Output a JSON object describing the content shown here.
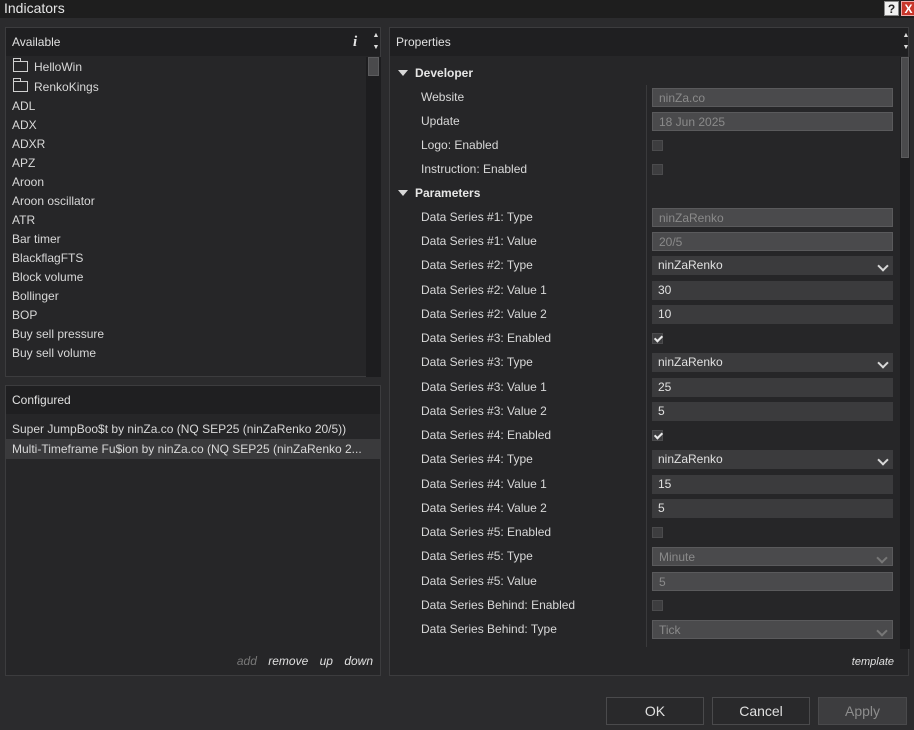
{
  "window": {
    "title": "Indicators",
    "help_label": "?",
    "close_label": "X"
  },
  "available": {
    "header": "Available",
    "info_label": "i",
    "items": [
      {
        "label": "HelloWin",
        "folder": true
      },
      {
        "label": "RenkoKings",
        "folder": true
      },
      {
        "label": "ADL"
      },
      {
        "label": "ADX"
      },
      {
        "label": "ADXR"
      },
      {
        "label": "APZ"
      },
      {
        "label": "Aroon"
      },
      {
        "label": "Aroon oscillator"
      },
      {
        "label": "ATR"
      },
      {
        "label": "Bar timer"
      },
      {
        "label": "BlackflagFTS"
      },
      {
        "label": "Block volume"
      },
      {
        "label": "Bollinger"
      },
      {
        "label": "BOP"
      },
      {
        "label": "Buy sell pressure"
      },
      {
        "label": "Buy sell volume"
      }
    ]
  },
  "configured": {
    "header": "Configured",
    "items": [
      "Super JumpBoo$t by ninZa.co (NQ SEP25 (ninZaRenko 20/5))",
      "Multi-Timeframe Fu$ion by ninZa.co (NQ SEP25 (ninZaRenko 2..."
    ],
    "selected_index": 1,
    "actions": {
      "add": "add",
      "remove": "remove",
      "up": "up",
      "down": "down"
    }
  },
  "properties": {
    "header": "Properties",
    "template_label": "template",
    "developer": {
      "title": "Developer",
      "rows": [
        {
          "label": "Website",
          "kind": "text",
          "value": "ninZa.co",
          "disabled": true
        },
        {
          "label": "Update",
          "kind": "text",
          "value": "18 Jun 2025",
          "disabled": true
        },
        {
          "label": "Logo: Enabled",
          "kind": "check",
          "checked": false
        },
        {
          "label": "Instruction: Enabled",
          "kind": "check",
          "checked": false
        }
      ]
    },
    "parameters": {
      "title": "Parameters",
      "rows": [
        {
          "label": "Data Series #1: Type",
          "kind": "text",
          "value": "ninZaRenko",
          "disabled": true
        },
        {
          "label": "Data Series #1: Value",
          "kind": "text",
          "value": "20/5",
          "disabled": true
        },
        {
          "label": "Data Series #2: Type",
          "kind": "select",
          "value": "ninZaRenko",
          "disabled": false
        },
        {
          "label": "Data Series #2: Value 1",
          "kind": "text",
          "value": "30",
          "disabled": false
        },
        {
          "label": "Data Series #2: Value 2",
          "kind": "text",
          "value": "10",
          "disabled": false
        },
        {
          "label": "Data Series #3: Enabled",
          "kind": "check",
          "checked": true
        },
        {
          "label": "Data Series #3: Type",
          "kind": "select",
          "value": "ninZaRenko",
          "disabled": false
        },
        {
          "label": "Data Series #3: Value 1",
          "kind": "text",
          "value": "25",
          "disabled": false
        },
        {
          "label": "Data Series #3: Value 2",
          "kind": "text",
          "value": "5",
          "disabled": false
        },
        {
          "label": "Data Series #4: Enabled",
          "kind": "check",
          "checked": true
        },
        {
          "label": "Data Series #4: Type",
          "kind": "select",
          "value": "ninZaRenko",
          "disabled": false
        },
        {
          "label": "Data Series #4: Value 1",
          "kind": "text",
          "value": "15",
          "disabled": false
        },
        {
          "label": "Data Series #4: Value 2",
          "kind": "text",
          "value": "5",
          "disabled": false
        },
        {
          "label": "Data Series #5: Enabled",
          "kind": "check",
          "checked": false
        },
        {
          "label": "Data Series #5: Type",
          "kind": "select",
          "value": "Minute",
          "disabled": true
        },
        {
          "label": "Data Series #5: Value",
          "kind": "text",
          "value": "5",
          "disabled": true
        },
        {
          "label": "Data Series Behind: Enabled",
          "kind": "check",
          "checked": false
        },
        {
          "label": "Data Series Behind: Type",
          "kind": "select",
          "value": "Tick",
          "disabled": true
        }
      ]
    }
  },
  "buttons": {
    "ok": "OK",
    "cancel": "Cancel",
    "apply": "Apply"
  }
}
